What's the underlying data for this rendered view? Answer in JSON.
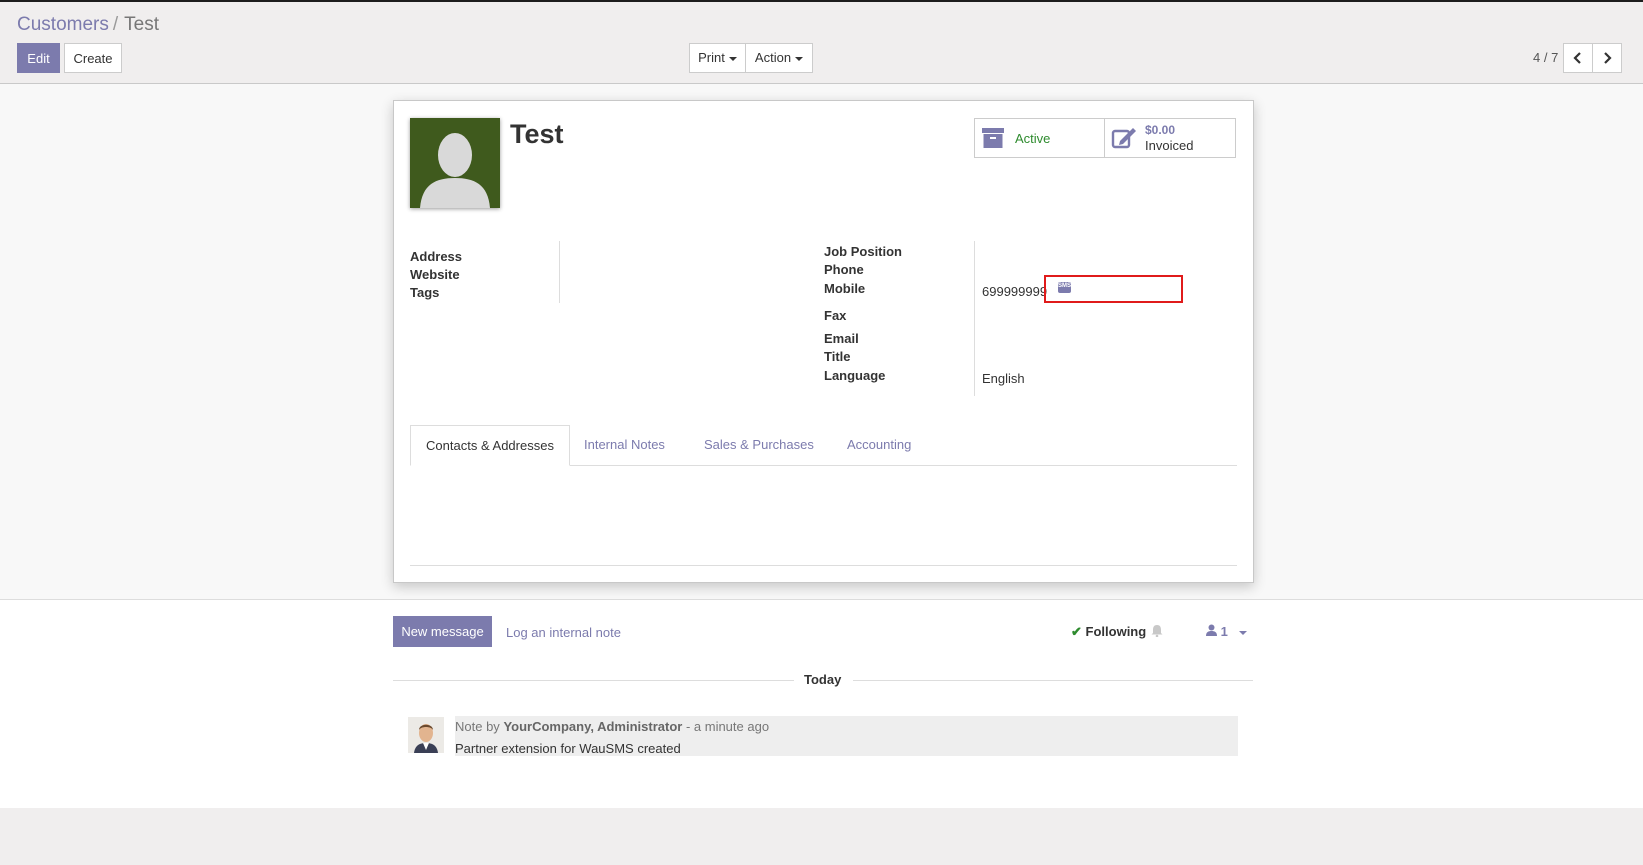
{
  "breadcrumb": {
    "parent": "Customers",
    "separator": "/",
    "current": "Test"
  },
  "buttons": {
    "edit": "Edit",
    "create": "Create",
    "print": "Print",
    "action": "Action"
  },
  "pager": {
    "value": "4 / 7"
  },
  "record": {
    "name": "Test",
    "smart_buttons": {
      "active": "Active",
      "invoiced_amount": "$0.00",
      "invoiced_label": "Invoiced"
    },
    "left_fields": [
      {
        "label": "Address",
        "value": ""
      },
      {
        "label": "Website",
        "value": ""
      },
      {
        "label": "Tags",
        "value": ""
      }
    ],
    "right_fields": {
      "job_position": {
        "label": "Job Position",
        "value": ""
      },
      "phone": {
        "label": "Phone",
        "value": ""
      },
      "mobile": {
        "label": "Mobile",
        "value": "699999999"
      },
      "fax": {
        "label": "Fax",
        "value": ""
      },
      "email": {
        "label": "Email",
        "value": ""
      },
      "title": {
        "label": "Title",
        "value": ""
      },
      "language": {
        "label": "Language",
        "value": "English"
      }
    },
    "sms_badge": "SMS"
  },
  "tabs": [
    "Contacts & Addresses",
    "Internal Notes",
    "Sales & Purchases",
    "Accounting"
  ],
  "chatter": {
    "new_message": "New message",
    "log_note": "Log an internal note",
    "following": "Following",
    "followers_count": "1",
    "today": "Today",
    "message": {
      "prefix": "Note by",
      "author": "YourCompany, Administrator",
      "time": "- a minute ago",
      "body": "Partner extension for WauSMS created"
    }
  },
  "colors": {
    "primary": "#7c7bad",
    "active_green": "#2e8b2e",
    "highlight_red": "#e01b1b"
  }
}
